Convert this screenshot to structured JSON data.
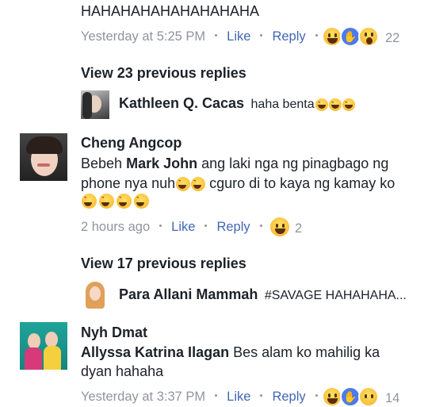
{
  "comment1": {
    "text": "HAHAHAHAHAHAHAHAHA",
    "time": "Yesterday at 5:25 PM",
    "like": "Like",
    "reply": "Reply",
    "reaction_count": "22",
    "reactions": [
      "haha-icon",
      "like-icon",
      "wow-icon"
    ]
  },
  "thread1": {
    "view_replies": "View 23 previous replies",
    "reply_name": "Kathleen Q. Cacas",
    "reply_text": "haha benta"
  },
  "comment2": {
    "name": "Cheng Angcop",
    "tag": "Mark John",
    "line1_pre": "Bebeh",
    "line1_post": "ang laki nga ng pinagbago ng",
    "line2_pre": "phone nya nuh",
    "line2_post": "cguro di to kaya ng kamay ko",
    "time": "2 hours ago",
    "like": "Like",
    "reply": "Reply",
    "reaction_count": "2"
  },
  "thread2": {
    "view_replies": "View 17 previous replies",
    "reply_name": "Para Allani Mammah",
    "reply_text": "#SAVAGE HAHAHAHA..."
  },
  "comment3": {
    "name": "Nyh Dmat",
    "tag": "Allyssa Katrina Ilagan",
    "line1_post": "Bes alam ko mahilig ka",
    "line2": "dyan hahaha",
    "time": "Yesterday at 3:37 PM",
    "like": "Like",
    "reply": "Reply",
    "reaction_count": "14"
  },
  "colors": {
    "link": "#4267b2",
    "meta": "#90949c",
    "text": "#1d2129"
  }
}
